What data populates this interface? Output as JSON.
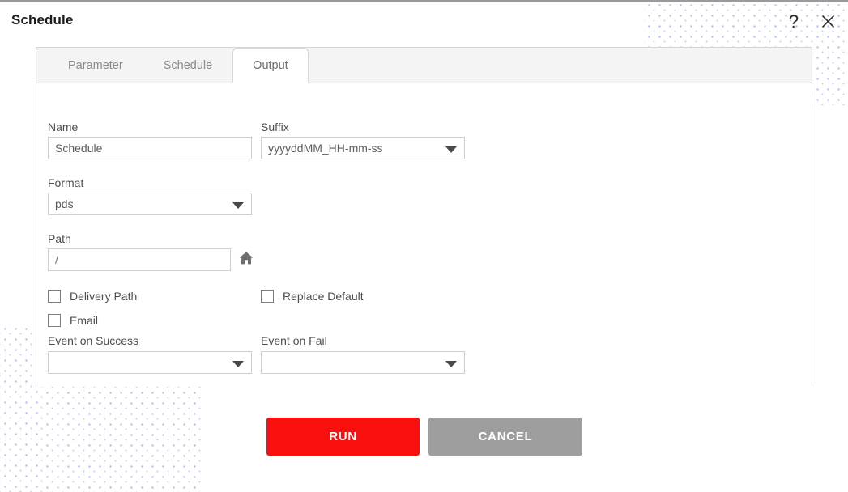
{
  "dialog": {
    "title": "Schedule",
    "help_icon": "?",
    "close_icon": "✕"
  },
  "tabs": [
    {
      "label": "Parameter",
      "active": false
    },
    {
      "label": "Schedule",
      "active": false
    },
    {
      "label": "Output",
      "active": true
    }
  ],
  "form": {
    "name": {
      "label": "Name",
      "value": "Schedule",
      "placeholder": "Schedule"
    },
    "suffix": {
      "label": "Suffix",
      "value": "yyyyddMM_HH-mm-ss"
    },
    "format": {
      "label": "Format",
      "value": "pds"
    },
    "path": {
      "label": "Path",
      "value": "/",
      "placeholder": "/",
      "home_icon": "home-icon"
    },
    "delivery_path": {
      "label": "Delivery Path",
      "checked": false
    },
    "replace_default": {
      "label": "Replace Default",
      "checked": false
    },
    "email": {
      "label": "Email",
      "checked": false
    },
    "event_on_success": {
      "label": "Event on Success",
      "value": ""
    },
    "event_on_fail": {
      "label": "Event on Fail",
      "value": ""
    }
  },
  "actions": {
    "run_label": "RUN",
    "cancel_label": "CANCEL"
  },
  "colors": {
    "run_button": "#fa0f0f",
    "cancel_button": "#9e9e9e",
    "dot_pattern": "#aab4e8",
    "panel_border": "#d6d6d6",
    "text": "#4d4d4d"
  }
}
